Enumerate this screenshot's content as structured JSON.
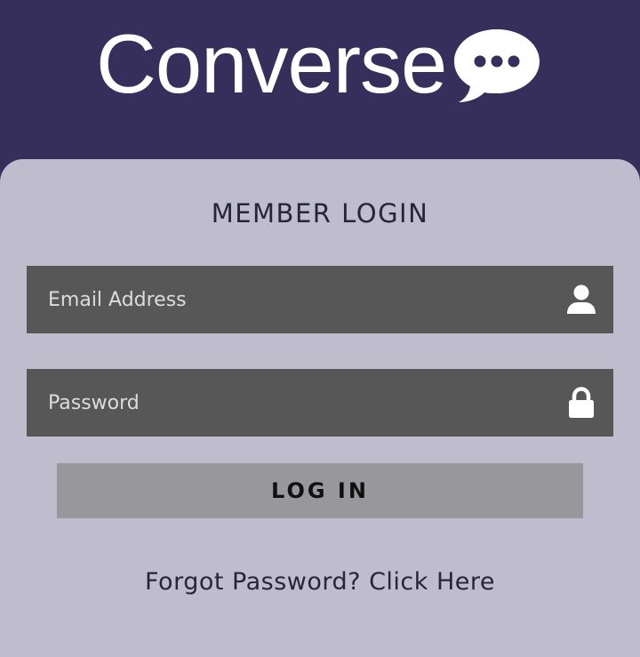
{
  "app": {
    "title": "Converse",
    "logo_icon": "speech-bubble-ellipsis-icon"
  },
  "colors": {
    "header_bg": "#362f5c",
    "panel_bg": "#bfbccd",
    "field_bg": "#575757",
    "button_bg": "#98979c"
  },
  "login": {
    "title": "MEMBER LOGIN",
    "email": {
      "placeholder": "Email Address",
      "value": "",
      "icon": "user-icon"
    },
    "password": {
      "placeholder": "Password",
      "value": "",
      "icon": "lock-icon"
    },
    "submit_label": "LOG IN",
    "forgot_prefix": "Forgot Password?",
    "forgot_link": "Click Here"
  }
}
